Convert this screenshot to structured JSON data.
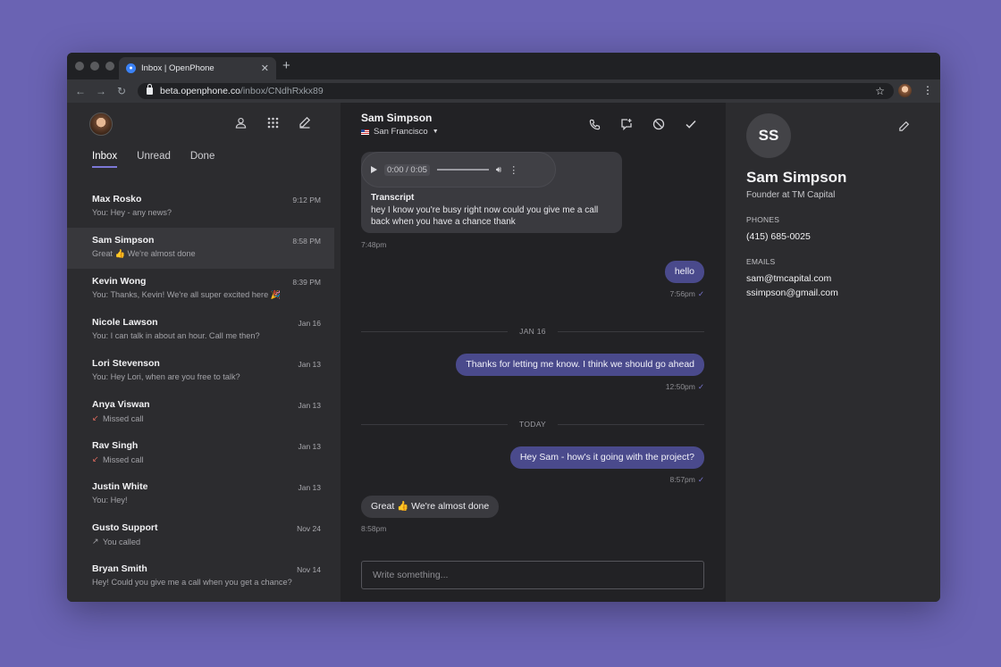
{
  "browser": {
    "tab_title": "Inbox | OpenPhone",
    "url_host": "beta.openphone.co",
    "url_path": "/inbox/CNdhRxkx89"
  },
  "sidebar": {
    "tabs": [
      "Inbox",
      "Unread",
      "Done"
    ],
    "active_tab": "Inbox",
    "conversations": [
      {
        "name": "Max Rosko",
        "time": "9:12 PM",
        "preview": "You: Hey - any news?",
        "icon": ""
      },
      {
        "name": "Sam Simpson",
        "time": "8:58 PM",
        "preview": "Great 👍  We're almost done",
        "icon": "",
        "selected": true
      },
      {
        "name": "Kevin Wong",
        "time": "8:39 PM",
        "preview": "You: Thanks, Kevin! We're all super excited here 🎉",
        "icon": ""
      },
      {
        "name": "Nicole Lawson",
        "time": "Jan 16",
        "preview": "You: I can talk in about an hour. Call me then?",
        "icon": ""
      },
      {
        "name": "Lori Stevenson",
        "time": "Jan 13",
        "preview": "You: Hey Lori, when are you free to talk?",
        "icon": ""
      },
      {
        "name": "Anya Viswan",
        "time": "Jan 13",
        "preview": "Missed call",
        "icon": "missed-call-icon"
      },
      {
        "name": "Rav Singh",
        "time": "Jan 13",
        "preview": "Missed call",
        "icon": "missed-call-icon"
      },
      {
        "name": "Justin White",
        "time": "Jan 13",
        "preview": "You: Hey!",
        "icon": ""
      },
      {
        "name": "Gusto Support",
        "time": "Nov 24",
        "preview": "You called",
        "icon": "outgoing-call-icon"
      },
      {
        "name": "Bryan Smith",
        "time": "Nov 14",
        "preview": "Hey! Could you give me a call when you get a chance?",
        "icon": ""
      }
    ]
  },
  "chat": {
    "contact_name": "Sam Simpson",
    "location": "San Francisco",
    "voicemail": {
      "time_display": "0:00 / 0:05",
      "transcript_label": "Transcript",
      "transcript": "hey I know you're busy right now could you give me a call back when you have a chance thank",
      "timestamp": "7:48pm"
    },
    "messages": [
      {
        "text": "hello",
        "timestamp": "7:56pm",
        "direction": "out"
      },
      {
        "text": "Thanks for letting me know. I think we should go ahead",
        "timestamp": "12:50pm",
        "direction": "out"
      },
      {
        "text": "Hey Sam - how's it going with the project?",
        "timestamp": "8:57pm",
        "direction": "out"
      },
      {
        "text": "Great 👍  We're almost done",
        "timestamp": "8:58pm",
        "direction": "in"
      }
    ],
    "dividers": [
      "JAN 16",
      "TODAY"
    ],
    "composer_placeholder": "Write something..."
  },
  "contact": {
    "initials": "SS",
    "name": "Sam Simpson",
    "role": "Founder at TM Capital",
    "phones_label": "PHONES",
    "phone": "(415) 685-0025",
    "emails_label": "EMAILS",
    "emails": [
      "sam@tmcapital.com",
      "ssimpson@gmail.com"
    ]
  },
  "colors": {
    "background": "#6a63b3",
    "accent": "#7c78d6",
    "outgoing_bubble": "#4a4a8c",
    "missed_call": "#e06b5f"
  }
}
